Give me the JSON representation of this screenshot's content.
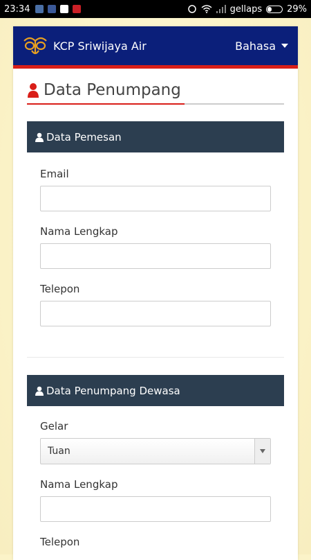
{
  "status_bar": {
    "time": "23:34",
    "carrier": "gellaps",
    "battery": "29%",
    "battery_level": 0.29,
    "icons": [
      "gallery-icon",
      "bbm-icon",
      "white-square-icon",
      "pinterest-icon",
      "sync-icon",
      "wifi-icon",
      "signal-icon",
      "battery-icon"
    ]
  },
  "navbar": {
    "brand": "KCP Sriwijaya Air",
    "language": "Bahasa",
    "bg_color": "#0b1f7a",
    "accent_color": "#d91e18"
  },
  "page": {
    "title": "Data Penumpang"
  },
  "sections": {
    "pemesan": {
      "title": "Data Pemesan",
      "email_label": "Email",
      "email_value": "",
      "name_label": "Nama Lengkap",
      "name_value": "",
      "phone_label": "Telepon",
      "phone_value": ""
    },
    "dewasa": {
      "title": "Data Penumpang Dewasa",
      "gelar_label": "Gelar",
      "gelar_selected": "Tuan",
      "name_label": "Nama Lengkap",
      "name_value": "",
      "phone_label": "Telepon"
    }
  }
}
